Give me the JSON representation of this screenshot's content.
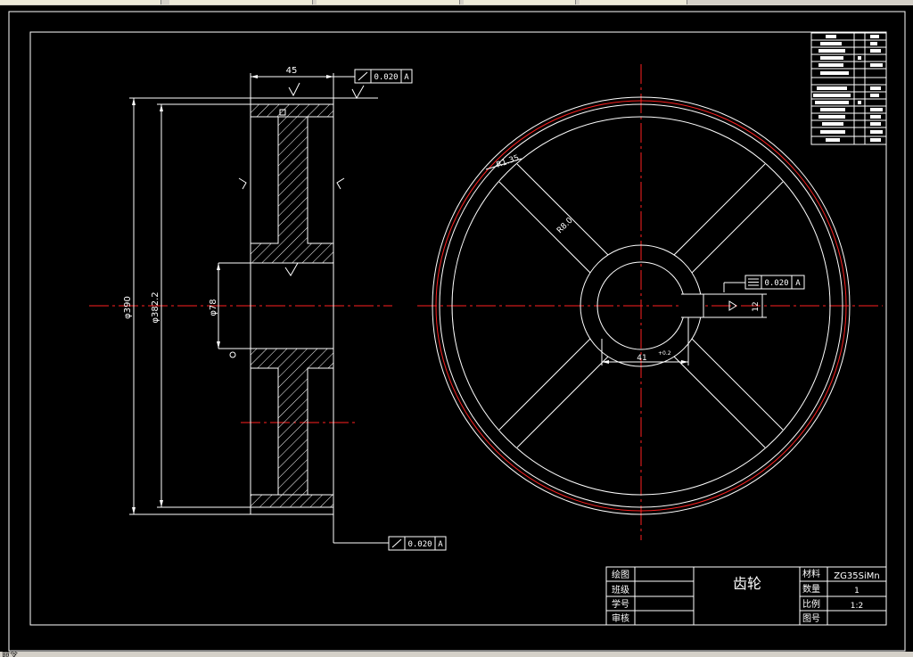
{
  "drawing": {
    "dimensions": {
      "width_45": "45",
      "outer_dia": "φ390",
      "tip_dia": "φ382.2",
      "bore_dia": "φ78",
      "fillet_r": "R1.35",
      "spoke_r": "R8.0",
      "key_width": "41",
      "key_depth": "12",
      "key_tol": "+0.2"
    },
    "tolerance_frames": {
      "runout_top": {
        "value": "0.020",
        "datum": "A"
      },
      "runout_bottom": {
        "value": "0.020",
        "datum": "A"
      },
      "symmetry": {
        "value": "0.020",
        "datum": "A"
      }
    }
  },
  "title_block": {
    "drawn_label": "绘图",
    "class_label": "班级",
    "student_label": "学号",
    "review_label": "审核",
    "part_name": "齿轮",
    "material_label": "材料",
    "material_value": "ZG35SiMn",
    "quantity_label": "数量",
    "quantity_value": "1",
    "scale_label": "比例",
    "scale_value": "1:2",
    "drawing_no_label": "图号"
  },
  "status": {
    "text": "命令"
  },
  "colors": {
    "line": "#ffffff",
    "center": "#ff2020",
    "background": "#000000"
  }
}
